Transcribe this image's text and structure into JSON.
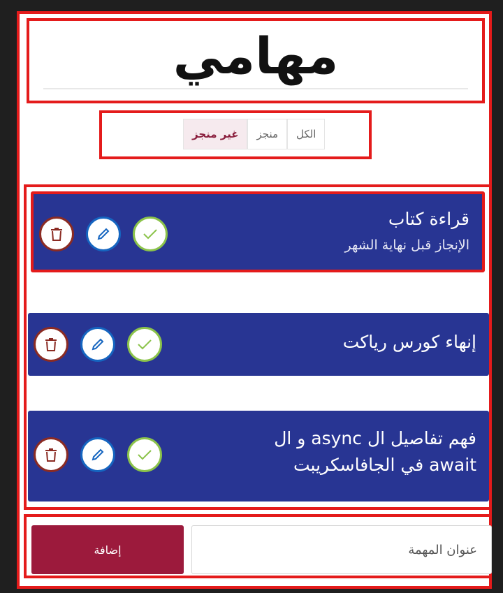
{
  "header": {
    "title": "مهامي"
  },
  "filters": {
    "all": "الكل",
    "done": "منجز",
    "not_done": "غير منجز",
    "active": "not_done"
  },
  "tasks": [
    {
      "title": "قراءة كتاب",
      "description": "الإنجاز قبل نهاية الشهر"
    },
    {
      "title": "إنهاء كورس رياكت",
      "description": ""
    },
    {
      "title": "فهم تفاصيل ال async و ال",
      "title_line2": "await في الجافاسكريبت",
      "description": ""
    }
  ],
  "add_form": {
    "input_placeholder": "عنوان المهمة",
    "button_label": "إضافة"
  },
  "colors": {
    "highlight": "#e41b1b",
    "task_background": "#283593",
    "add_button": "#9c1a3c",
    "delete": "#8b2b23",
    "edit": "#1565c0",
    "complete": "#8bc34a"
  },
  "icons": [
    "trash-icon",
    "pencil-icon",
    "check-icon"
  ]
}
